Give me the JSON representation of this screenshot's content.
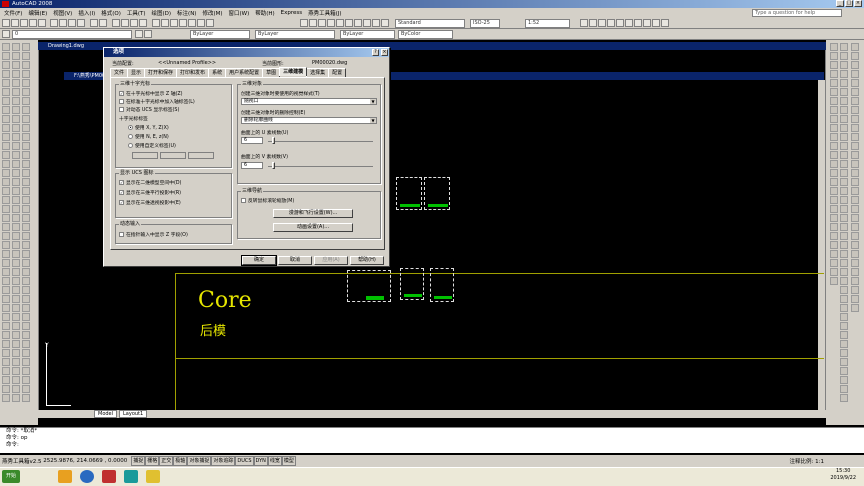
{
  "app": {
    "title": "AutoCAD 2008",
    "help_placeholder": "Type a question for help",
    "menu": [
      "文件(F)",
      "编辑(E)",
      "视图(V)",
      "插入(I)",
      "格式(O)",
      "工具(T)",
      "绘图(D)",
      "标注(N)",
      "修改(M)",
      "窗口(W)",
      "帮助(H)",
      "Express",
      "燕秀工具箱(J)"
    ]
  },
  "toolbars": {
    "layer_combo": "0",
    "color_combo": "ByLayer",
    "linetype_combo": "ByLayer",
    "lineweight_combo": "ByLayer",
    "plotstyle_combo": "ByColor",
    "scale_combo": "1:52",
    "dim_combo": "ISO-25",
    "style_combo": "Standard"
  },
  "documents": {
    "back_title": "Drawing1.dwg",
    "front_title": "F:\\燕秀\\PM00020.dwg"
  },
  "drawing": {
    "core_text": "Core",
    "houmo_text": "后模",
    "ucs_y": "Y",
    "tabs": [
      "Model",
      "Layout1"
    ]
  },
  "dialog": {
    "title": "选项",
    "help_q": "?",
    "close": "×",
    "current_profile_label": "当前配置:",
    "current_profile_value": "<<Unnamed Profile>>",
    "current_drawing_label": "当前图形:",
    "current_drawing_value": "PM00020.dwg",
    "tabs": [
      "文件",
      "显示",
      "打开和保存",
      "打印和发布",
      "系统",
      "用户系统配置",
      "草图",
      "三维建模",
      "选择集",
      "配置"
    ],
    "active_tab_index": 7,
    "crosshair_group": {
      "title": "三维十字光标",
      "opt1": "在十字光标中显示 Z 轴(Z)",
      "opt2": "在标准十字光标中加入轴标签(L)",
      "opt3": "对动态 UCS 显示标签(S)",
      "labels_title": "十字光标标签",
      "radio1": "使用 X, Y, Z(X)",
      "radio2": "使用 N, E, z(N)",
      "radio3": "使用自定义标签(U)"
    },
    "ucs_group": {
      "title": "显示 UCS 图标",
      "opt1": "显示在二维模型空间中(D)",
      "opt2": "显示在三维平行投影中(R)",
      "opt3": "显示在三维透视投影中(E)"
    },
    "dynamic_group": {
      "title": "动态输入",
      "opt1": "在指针输入中显示 Z 字段(O)"
    },
    "objects_group": {
      "title": "三维对象",
      "label1": "创建三维对象时要使用的视觉样式(T)",
      "value1": "随视口",
      "label2": "创建三维对象时的删除控制(E)",
      "value2": "删除轮廓曲线",
      "label3": "曲面上的 U 素线数(U)",
      "value3": "6",
      "label4": "曲面上的 V 素线数(V)",
      "value4": "6"
    },
    "nav_group": {
      "title": "三维导航",
      "opt1": "反转鼠标滚轮缩放(M)",
      "btn1": "漫游和飞行设置(W)...",
      "btn2": "动画设置(A)..."
    },
    "buttons": {
      "ok": "确定",
      "cancel": "取消",
      "apply": "应用(A)",
      "help": "帮助(H)"
    }
  },
  "command": {
    "line1": "命令: *取消*",
    "line2": "命令: op",
    "line3": "命令:"
  },
  "status": {
    "coords": "2525.9876, 214.0669 , 0.0000",
    "toggles": [
      "捕捉",
      "栅格",
      "正交",
      "极轴",
      "对象捕捉",
      "对象追踪",
      "DUCS",
      "DYN",
      "线宽",
      "模型"
    ],
    "prefix": "燕秀工具箱v2.5",
    "annotation_scale": "注释比例: 1:1"
  },
  "taskbar": {
    "start": "开始",
    "time": "15:30",
    "date": "2019/9/22"
  }
}
